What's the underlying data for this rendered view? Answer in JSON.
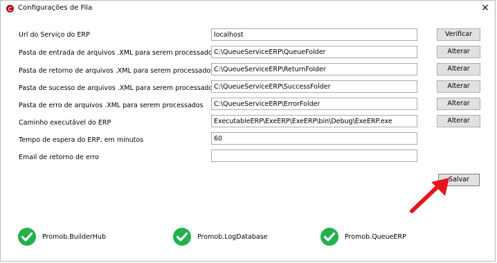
{
  "window": {
    "title": "Configurações de Fila",
    "close_glyph": "✕"
  },
  "form": {
    "rows": [
      {
        "label": "Url do Serviço do ERP",
        "value": "localhost",
        "button": "Verificar"
      },
      {
        "label": "Pasta de entrada de arquivos .XML para serem processados",
        "value": "C:\\QueueServiceERP\\QueueFolder",
        "button": "Alterar"
      },
      {
        "label": "Pasta de retorno de arquivos .XML para serem processados",
        "value": "C:\\QueueServiceERP\\ReturnFolder",
        "button": "Alterar"
      },
      {
        "label": "Pasta de sucesso de arquivos .XML para serem processados",
        "value": "C:\\QueueServiceERP\\SuccessFolder",
        "button": "Alterar"
      },
      {
        "label": "Pasta de erro de arquivos .XML para serem processados",
        "value": "C:\\QueueServiceERP\\ErrorFolder",
        "button": "Alterar"
      },
      {
        "label": "Caminho executável do ERP",
        "value": "ExecutableERP\\ExeERP\\ExeERP\\bin\\Debug\\ExeERP.exe",
        "button": "Alterar"
      },
      {
        "label": "Tempo de espera do ERP, em minutos",
        "value": "60"
      },
      {
        "label": "Email de retorno de erro",
        "value": ""
      }
    ],
    "save_label": "Salvar"
  },
  "status_items": [
    {
      "label": "Promob.BuilderHub",
      "icon": "check-circle-icon",
      "color": "#22b14c"
    },
    {
      "label": "Promob.LogDatabase",
      "icon": "check-circle-icon",
      "color": "#22b14c"
    },
    {
      "label": "Promob.QueueERP",
      "icon": "check-circle-icon",
      "color": "#22b14c"
    }
  ],
  "colors": {
    "accent_arrow": "#e8141b",
    "status_ok": "#22b14c",
    "app_icon": "#c8101e"
  }
}
